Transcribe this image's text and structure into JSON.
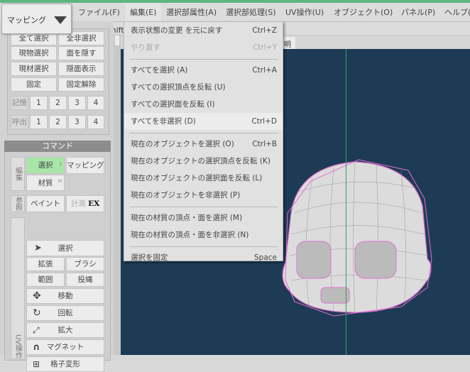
{
  "mode_dropdown": {
    "value": "マッピング"
  },
  "menubar": [
    "ファイル(F)",
    "編集(E)",
    "選択部属性(A)",
    "選択部処理(S)",
    "UV操作(U)",
    "オブジェクト(O)",
    "パネル(P)",
    "ヘルプ("
  ],
  "toolbar": {
    "hint": "L：選択  Shift"
  },
  "view_tab": "明",
  "left_panel": {
    "rows": [
      [
        "全て選択",
        "全非選択"
      ],
      [
        "現物選択",
        "面を隠す"
      ],
      [
        "現材選択",
        "隠面表示"
      ],
      [
        "固定",
        "固定解除"
      ]
    ],
    "memory": {
      "label": "記憶",
      "slots": [
        "1",
        "2",
        "3",
        "4"
      ]
    },
    "recall": {
      "label": "呼出",
      "slots": [
        "1",
        "2",
        "3",
        "4"
      ]
    }
  },
  "command": {
    "title": "コマンド",
    "edit_label": "編集",
    "select": "選択",
    "select_key": "S",
    "mapping": "マッピング",
    "material": "材質",
    "material_key": "M",
    "ref_label": "参照",
    "paint": "ペイント",
    "measure": "計測",
    "measure_badge": "EX",
    "uv_label": "UV操作",
    "tools": {
      "select": "選択",
      "expand": "拡張",
      "brush": "ブラシ",
      "range": "範囲",
      "lasso": "投縄",
      "move": "移動",
      "rotate": "回転",
      "scale": "拡大",
      "magnet": "マグネット",
      "lattice": "格子変形"
    }
  },
  "edit_menu": {
    "groups": [
      [
        {
          "label": "表示状態の変更 を元に戻す",
          "shortcut": "Ctrl+Z"
        },
        {
          "label": "やり直す",
          "shortcut": "Ctrl+Y",
          "disabled": true
        }
      ],
      [
        {
          "label": "すべてを選択 (A)",
          "shortcut": "Ctrl+A"
        },
        {
          "label": "すべての選択頂点を反転 (U)",
          "shortcut": ""
        },
        {
          "label": "すべての選択面を反転 (I)",
          "shortcut": ""
        },
        {
          "label": "すべてを非選択 (D)",
          "shortcut": "Ctrl+D",
          "hover": true
        }
      ],
      [
        {
          "label": "現在のオブジェクトを選択 (O)",
          "shortcut": "Ctrl+B"
        },
        {
          "label": "現在のオブジェクトの選択頂点を反転 (K)",
          "shortcut": ""
        },
        {
          "label": "現在のオブジェクトの選択面を反転 (L)",
          "shortcut": ""
        },
        {
          "label": "現在のオブジェクトを非選択 (P)",
          "shortcut": ""
        }
      ],
      [
        {
          "label": "現在の材質の頂点・面を選択 (M)",
          "shortcut": ""
        },
        {
          "label": "現在の材質の頂点・面を非選択 (N)",
          "shortcut": ""
        }
      ],
      [
        {
          "label": "選択を固定",
          "shortcut": "Space"
        }
      ]
    ]
  },
  "colors": {
    "accent": "#5bb87c",
    "viewport": "#1d3b55",
    "selected": "#a8e6a8",
    "wire": "#e070d0"
  }
}
